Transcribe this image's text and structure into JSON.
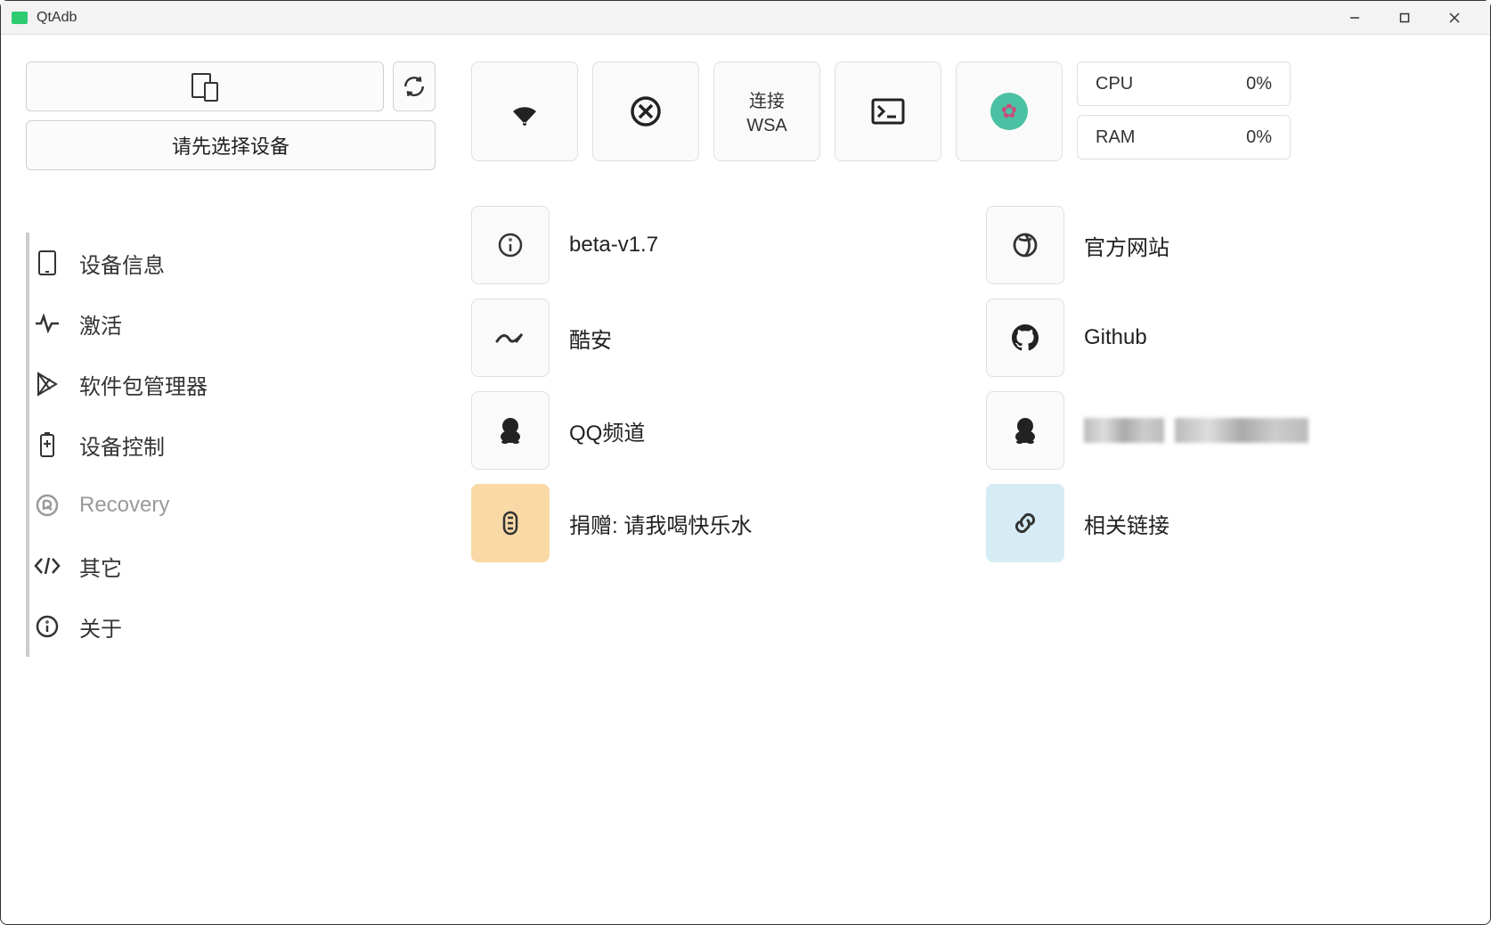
{
  "window": {
    "title": "QtAdb"
  },
  "device": {
    "select_prompt": "请先选择设备"
  },
  "toolbar": {
    "connect_wsa_line1": "连接",
    "connect_wsa_line2": "WSA"
  },
  "stats": {
    "cpu_label": "CPU",
    "cpu_value": "0%",
    "ram_label": "RAM",
    "ram_value": "0%"
  },
  "sidebar": {
    "items": [
      {
        "label": "设备信息",
        "name": "device-info"
      },
      {
        "label": "激活",
        "name": "activate"
      },
      {
        "label": "软件包管理器",
        "name": "package-manager"
      },
      {
        "label": "设备控制",
        "name": "device-control"
      },
      {
        "label": "Recovery",
        "name": "recovery",
        "muted": true
      },
      {
        "label": "其它",
        "name": "other"
      },
      {
        "label": "关于",
        "name": "about"
      }
    ]
  },
  "links": {
    "version": "beta-v1.7",
    "website": "官方网站",
    "coolapk": "酷安",
    "github": "Github",
    "qq": "QQ频道",
    "donate": "捐赠: 请我喝快乐水",
    "related": "相关链接"
  }
}
